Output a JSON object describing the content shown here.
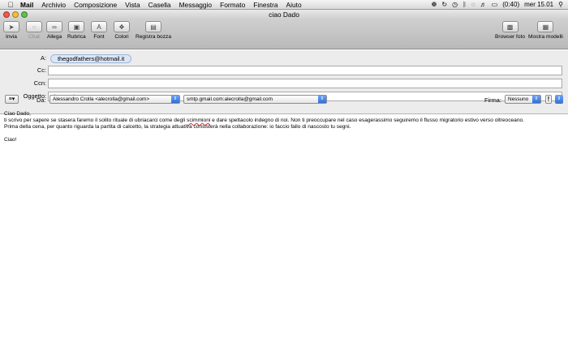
{
  "menubar": {
    "app": "Mail",
    "items": [
      "Archivio",
      "Composizione",
      "Vista",
      "Casella",
      "Messaggio",
      "Formato",
      "Finestra",
      "Aiuto"
    ],
    "battery": "(0:40)",
    "clock": "mer 15.01"
  },
  "window": {
    "title": "ciao Dado"
  },
  "toolbar": {
    "send": "Invia",
    "chat": "Chat",
    "attach": "Allega",
    "addressbook": "Rubrica",
    "fonts": "Font",
    "colors": "Colori",
    "save_draft": "Registra bozza",
    "photo_browser": "Browser foto",
    "templates": "Mostra modelli"
  },
  "header": {
    "to_label": "A:",
    "to_token": "thegodfathers@hotmail.it",
    "cc_label": "Cc:",
    "cc_value": "",
    "bcc_label": "Ccn:",
    "bcc_value": "",
    "subject_label": "Oggetto:",
    "subject_value": "ciao Dado",
    "from_label": "Da:",
    "from_value": "Alessandro Crolla <alecrolla@gmail.com>",
    "smtp_value": "smtp.gmail.com:alecrolla@gmail.com",
    "signature_label": "Firma:",
    "signature_value": "Nessuno",
    "priority": "!"
  },
  "message": {
    "line1": "Ciao Dado,",
    "line2_a": "ti scrivo per sapere se stasera faremo il solito rituale di ubriacarci come degli ",
    "line2_misspelled": "scimmioni",
    "line2_b": " e dare spettacolo indegno di noi. Non ti preoccupare nel caso esagerassimo seguiremo il flusso migratorio estivo verso oltreoceano.",
    "line3": "Prima della cena, per quanto riguarda la partita di calcetto, la strategia attuativa consisterà nella collaborazione: io faccio fallo di nascosto tu segni.",
    "line4": "Ciao!"
  }
}
